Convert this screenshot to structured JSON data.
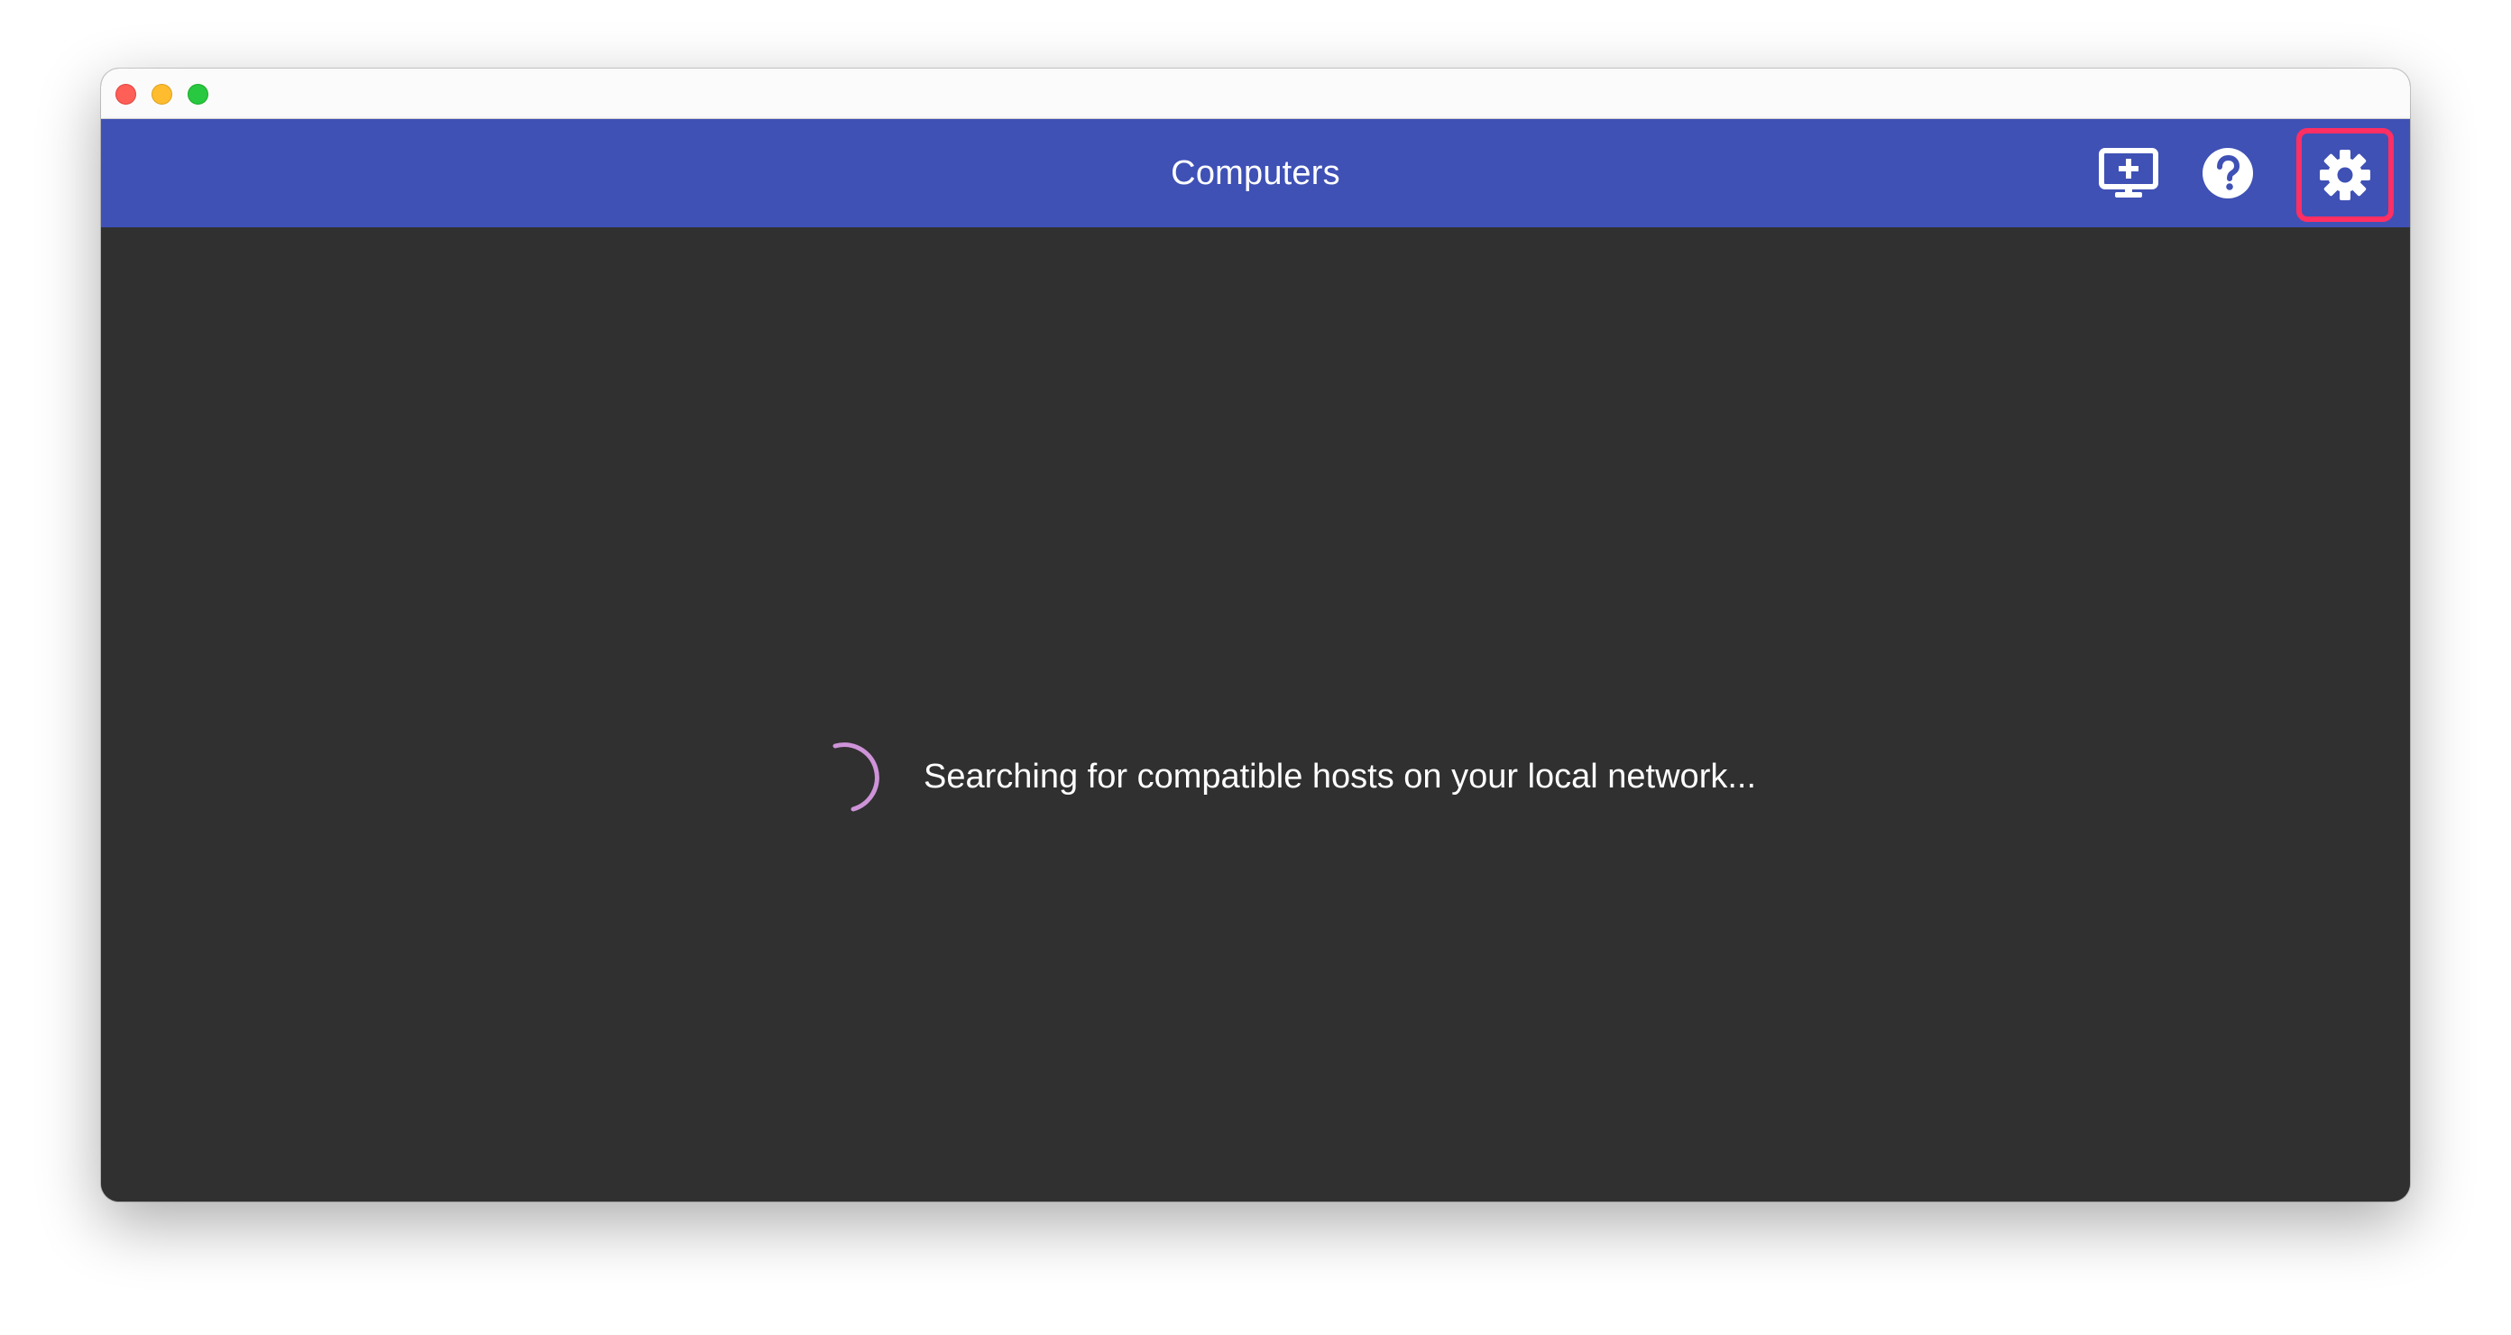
{
  "window": {
    "controls": {
      "close": "close-icon",
      "minimize": "minimize-icon",
      "maximize": "maximize-icon"
    }
  },
  "appbar": {
    "title": "Computers",
    "background_color": "#3f51b5",
    "actions": [
      {
        "name": "add-host",
        "icon": "monitor-plus-icon"
      },
      {
        "name": "help",
        "icon": "help-circle-icon"
      },
      {
        "name": "settings",
        "icon": "gear-icon",
        "highlighted": true,
        "highlight_color": "#ff2f63"
      }
    ]
  },
  "content": {
    "status_text": "Searching for compatible hosts on your local network...",
    "spinner_color": "#ce93d8",
    "background_color": "#303030"
  }
}
